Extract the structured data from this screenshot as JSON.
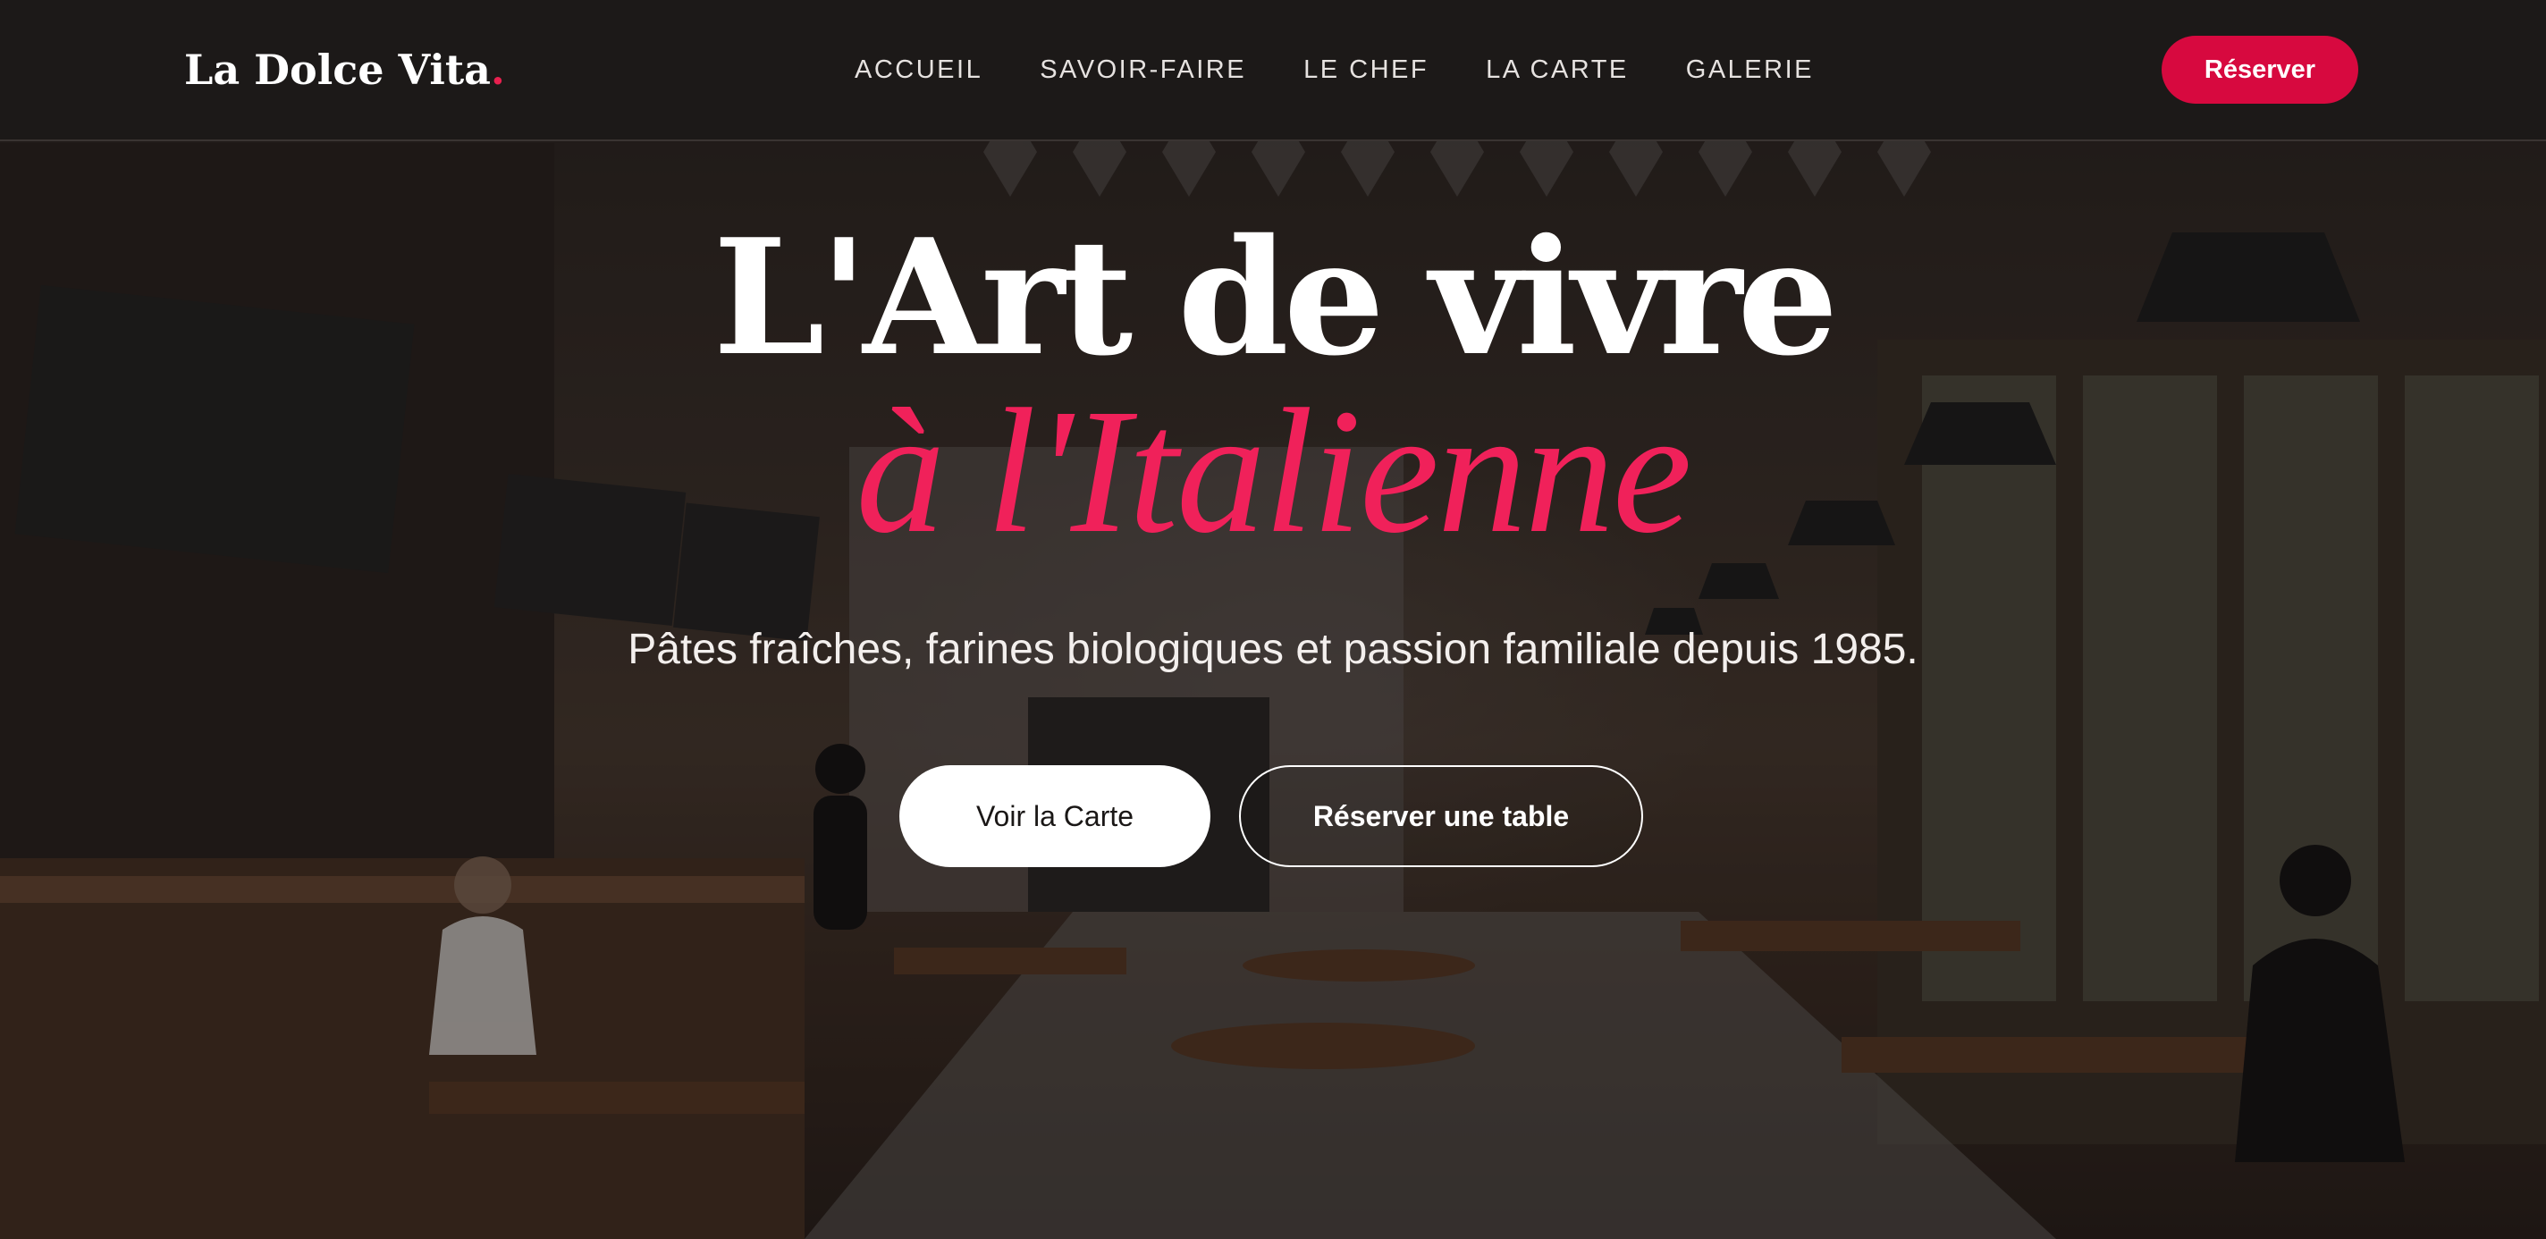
{
  "header": {
    "brand_name": "La Dolce Vita",
    "brand_dot": ".",
    "nav_items": [
      {
        "label": "ACCUEIL"
      },
      {
        "label": "SAVOIR-FAIRE"
      },
      {
        "label": "LE CHEF"
      },
      {
        "label": "LA CARTE"
      },
      {
        "label": "GALERIE"
      }
    ],
    "reserve_label": "Réserver"
  },
  "hero": {
    "title_line1": "L'Art de vivre",
    "title_line2": "à l'Italienne",
    "subtitle": "Pâtes fraîches, farines biologiques et passion familiale depuis 1985.",
    "primary_cta": "Voir la Carte",
    "secondary_cta": "Réserver une table"
  },
  "colors": {
    "accent": "#d7093f",
    "accent_text": "#f0215a",
    "navbar_bg": "#1c1918"
  }
}
